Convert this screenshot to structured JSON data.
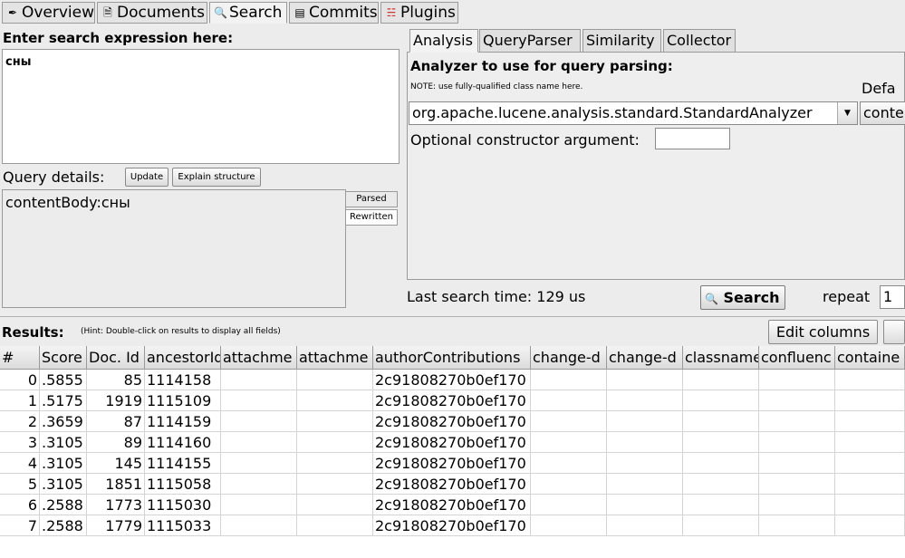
{
  "tabs": [
    {
      "label": "Overview",
      "icon": "overview-icon"
    },
    {
      "label": "Documents",
      "icon": "documents-icon"
    },
    {
      "label": "Search",
      "icon": "search-icon"
    },
    {
      "label": "Commits",
      "icon": "commits-icon"
    },
    {
      "label": "Plugins",
      "icon": "plugins-icon"
    }
  ],
  "search": {
    "expression_title": "Enter search expression here:",
    "expression_value": "сны",
    "query_details_label": "Query details:",
    "update_button": "Update",
    "explain_button": "Explain structure",
    "query_text": "contentBody:сны",
    "parsed_label": "Parsed",
    "rewritten_label": "Rewritten"
  },
  "analysis": {
    "tabs": [
      "Analysis",
      "QueryParser",
      "Similarity",
      "Collector"
    ],
    "title": "Analyzer to use for query parsing:",
    "note": "NOTE: use fully-qualified class name here.",
    "analyzer_value": "org.apache.lucene.analysis.standard.StandardAnalyzer",
    "default_label": "Defa",
    "cont_button": "conte",
    "constructor_label": "Optional constructor argument:",
    "constructor_value": ""
  },
  "status": {
    "last_search": "Last search time: 129 us",
    "search_button": "Search",
    "repeat_label": "repeat",
    "repeat_value": "1"
  },
  "results": {
    "label": "Results:",
    "hint": "(Hint: Double-click on results to display all fields)",
    "edit_columns": "Edit columns",
    "columns": [
      "#",
      "Score",
      "Doc. Id",
      "ancestorIds",
      "attachme",
      "attachme",
      "authorContributions",
      "change-d",
      "change-d",
      "classname",
      "confluenc",
      "containe"
    ],
    "rows": [
      [
        "0",
        ".5855",
        "85",
        "1114158",
        "",
        "",
        "2c91808270b0ef170",
        "",
        "",
        "",
        "",
        ""
      ],
      [
        "1",
        ".5175",
        "1919",
        "1115109",
        "",
        "",
        "2c91808270b0ef170",
        "",
        "",
        "",
        "",
        ""
      ],
      [
        "2",
        ".3659",
        "87",
        "1114159",
        "",
        "",
        "2c91808270b0ef170",
        "",
        "",
        "",
        "",
        ""
      ],
      [
        "3",
        ".3105",
        "89",
        "1114160",
        "",
        "",
        "2c91808270b0ef170",
        "",
        "",
        "",
        "",
        ""
      ],
      [
        "4",
        ".3105",
        "145",
        "1114155",
        "",
        "",
        "2c91808270b0ef170",
        "",
        "",
        "",
        "",
        ""
      ],
      [
        "5",
        ".3105",
        "1851",
        "1115058",
        "",
        "",
        "2c91808270b0ef170",
        "",
        "",
        "",
        "",
        ""
      ],
      [
        "6",
        ".2588",
        "1773",
        "1115030",
        "",
        "",
        "2c91808270b0ef170",
        "",
        "",
        "",
        "",
        ""
      ],
      [
        "7",
        ".2588",
        "1779",
        "1115033",
        "",
        "",
        "2c91808270b0ef170",
        "",
        "",
        "",
        "",
        ""
      ]
    ]
  }
}
